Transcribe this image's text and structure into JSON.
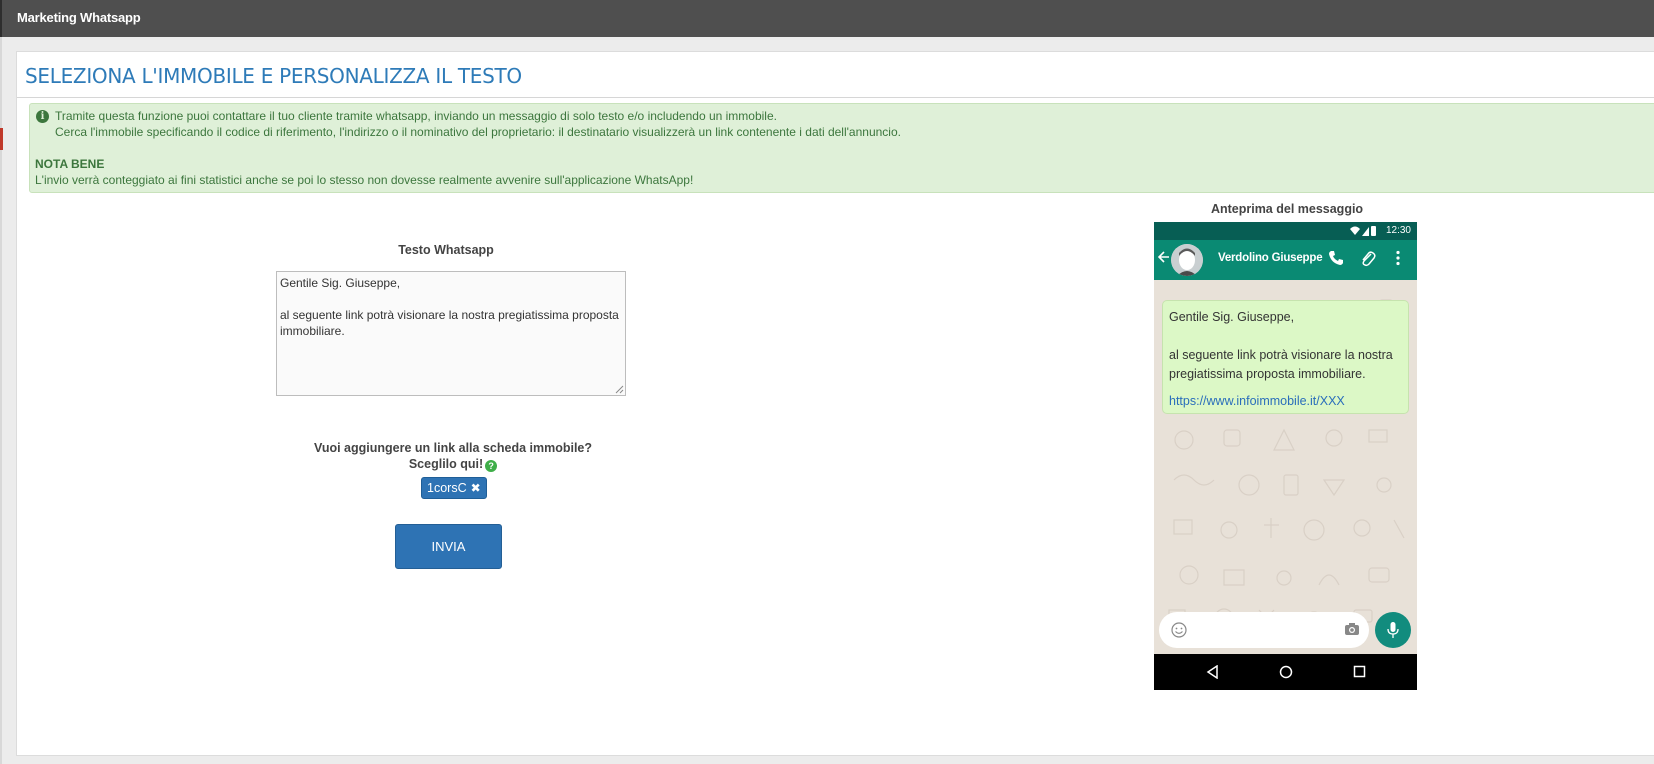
{
  "window": {
    "title": "Marketing Whatsapp"
  },
  "panel": {
    "title": "SELEZIONA L'IMMOBILE E PERSONALIZZA IL TESTO"
  },
  "alert": {
    "line1": "Tramite questa funzione puoi contattare il tuo cliente tramite whatsapp, inviando un messaggio di solo testo e/o includendo un immobile.",
    "line2": "Cerca l'immobile specificando il codice di riferimento, l'indirizzo o il nominativo del proprietario: il destinatario visualizzerà un link contenente i dati dell'annuncio.",
    "nota_title": "NOTA BENE",
    "nota_text": "L'invio verrà conteggiato ai fini statistici anche se poi lo stesso non dovesse realmente avvenire sull'applicazione WhatsApp!"
  },
  "form": {
    "text_label": "Testo Whatsapp",
    "text_value": "Gentile Sig. Giuseppe,\n\nal seguente link potrà visionare la nostra pregiatissima proposta immobiliare.",
    "link_question_1": "Vuoi aggiungere un link alla scheda immobile?",
    "link_question_2": "Sceglilo qui!",
    "selected_tag": "1corsC",
    "send_label": "INVIA"
  },
  "preview": {
    "label": "Anteprima del messaggio",
    "time": "12:30",
    "contact_name": "Verdolino Giuseppe",
    "message": "Gentile Sig. Giuseppe,\n\nal seguente link potrà visionare la nostra pregiatissima proposta immobiliare.",
    "link": "https://www.infoimmobile.it/XXX"
  },
  "colors": {
    "accent": "#2e73b4",
    "title_blue": "#2e7bb8",
    "alert_bg": "#dff0d8",
    "alert_text": "#3c763d",
    "wa_header": "#0a8a73",
    "wa_bubble": "#dcf8c6"
  },
  "icons": [
    "info-icon",
    "help-icon",
    "remove-tag-icon",
    "back-arrow-icon",
    "avatar",
    "phone-icon",
    "attach-icon",
    "more-icon",
    "wifi-icon",
    "signal-icon",
    "battery-icon",
    "emoji-icon",
    "camera-icon",
    "mic-icon",
    "nav-back-icon",
    "nav-home-icon",
    "nav-recents-icon"
  ]
}
